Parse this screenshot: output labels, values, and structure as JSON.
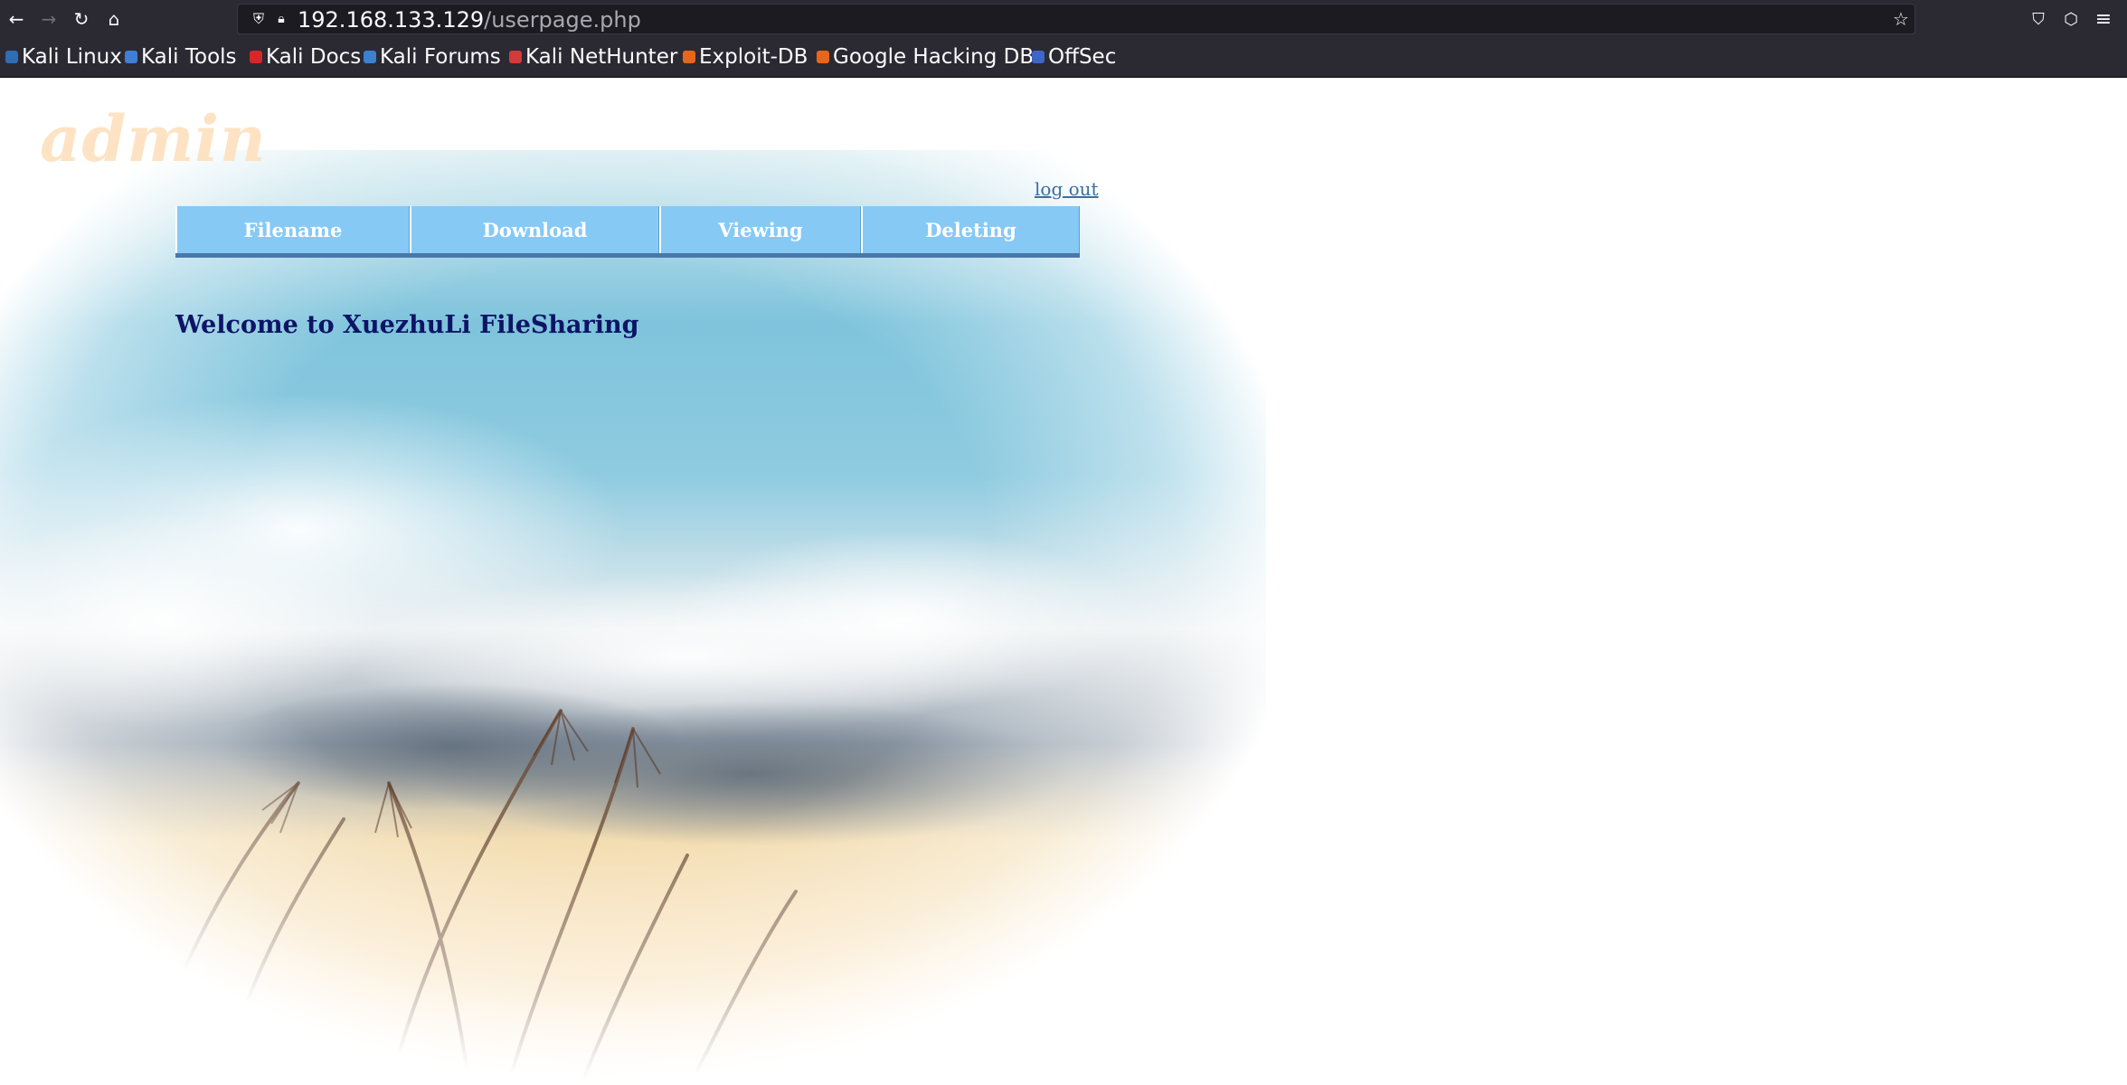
{
  "browser": {
    "url_host": "192.168.133.129",
    "url_path": "/userpage.php",
    "nav": {
      "back_icon": "←",
      "forward_icon": "→",
      "reload_icon": "↻",
      "home_icon": "⌂"
    },
    "url_icons": {
      "shield_icon": "⛨",
      "lock_icon": "🔒︎",
      "star_icon": "☆"
    },
    "right_icons": {
      "pocket_icon": "⛉",
      "extensions_icon": "⬡",
      "menu_icon": "≡"
    },
    "bookmarks": [
      {
        "label": "Kali Linux",
        "color": "#2f6db5"
      },
      {
        "label": "Kali Tools",
        "color": "#3f7fd6"
      },
      {
        "label": "Kali Docs",
        "color": "#d8262a"
      },
      {
        "label": "Kali Forums",
        "color": "#3a82d1"
      },
      {
        "label": "Kali NetHunter",
        "color": "#d33a3a"
      },
      {
        "label": "Exploit-DB",
        "color": "#e8661b"
      },
      {
        "label": "Google Hacking DB",
        "color": "#e8661b"
      },
      {
        "label": "OffSec",
        "color": "#3d66c9"
      }
    ]
  },
  "page": {
    "admin_title": "admin",
    "logout_label": "log out",
    "menu": [
      "Filename",
      "Download",
      "Viewing",
      "Deleting"
    ],
    "welcome": "Welcome to XuezhuLi FileSharing"
  },
  "colors": {
    "menu_bg": "#86c9f5",
    "menu_border": "#4a78aa",
    "welcome_text": "#0d1466",
    "admin_text": "#fde3c4",
    "link": "#3c6ea3"
  }
}
